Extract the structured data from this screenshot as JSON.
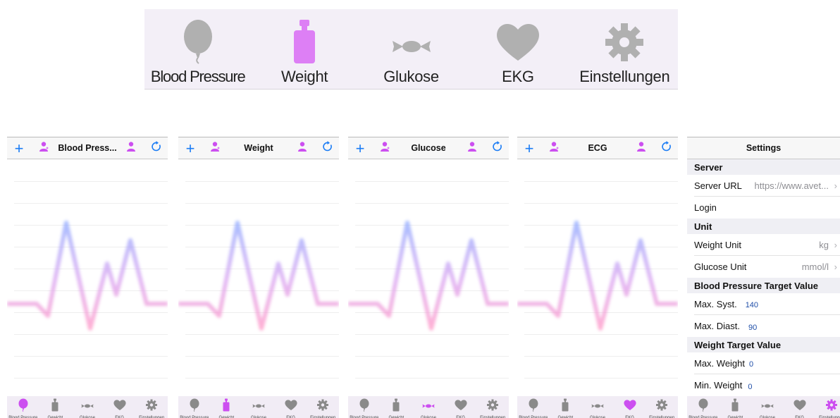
{
  "big_tabbar": {
    "tabs": [
      {
        "label": "Blood Pressure",
        "icon": "balloon-icon",
        "color": "#b0b0b0"
      },
      {
        "label": "Weight",
        "icon": "weight-icon",
        "color": "#dd7ff5"
      },
      {
        "label": "Glukose",
        "icon": "candy-icon",
        "color": "#b0b0b0"
      },
      {
        "label": "EKG",
        "icon": "heart-icon",
        "color": "#b0b0b0"
      },
      {
        "label": "Einstellungen",
        "icon": "gear-icon",
        "color": "#b0b0b0"
      }
    ]
  },
  "screens": [
    {
      "title": "Blood Press...",
      "active_tab": 0
    },
    {
      "title": "Weight",
      "active_tab": 1
    },
    {
      "title": "Glucose",
      "active_tab": 2
    },
    {
      "title": "ECG",
      "active_tab": 3
    }
  ],
  "mini_tabbar": {
    "tabs": [
      "Blood Pressure",
      "Gewicht",
      "Glukose",
      "EKG",
      "Einstellungen"
    ]
  },
  "colors": {
    "accent": "#1a7cf5",
    "purple": "#cc4ff0",
    "inactive_icon": "#8a8a8a"
  },
  "settings": {
    "title": "Settings",
    "sections": {
      "server": "Server",
      "unit": "Unit",
      "bp_target": "Blood Pressure Target Value",
      "weight_target": "Weight Target Value"
    },
    "rows": {
      "server_url_label": "Server URL",
      "server_url_value": "https://www.avet...",
      "login_label": "Login",
      "weight_unit_label": "Weight Unit",
      "weight_unit_value": "kg",
      "glucose_unit_label": "Glucose Unit",
      "glucose_unit_value": "mmol/l",
      "max_syst_label": "Max. Syst.",
      "max_syst_value": "140",
      "max_diast_label": "Max. Diast.",
      "max_diast_value": "90",
      "max_weight_label": "Max. Weight",
      "max_weight_value": "0",
      "min_weight_label": "Min. Weight",
      "min_weight_value": "0"
    }
  }
}
